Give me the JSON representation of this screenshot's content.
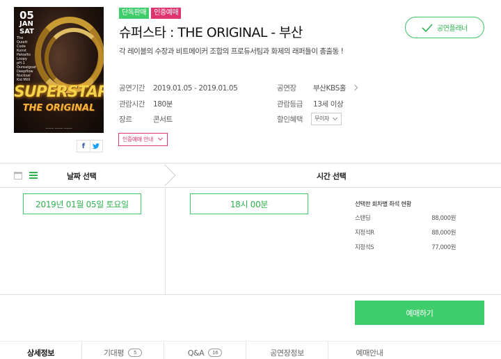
{
  "poster": {
    "date_line1": "05",
    "date_line2": "JAN",
    "date_line3": "SAT",
    "main_title": "SUPERSTAR",
    "sub_title": "THE ORIGINAL"
  },
  "share": {
    "facebook": "f",
    "twitter": "🐦"
  },
  "badges": [
    "단독판매",
    "인증예매"
  ],
  "title": "슈퍼스타 : THE ORIGINAL - 부산",
  "subtitle": "각 레이블의 수장과 비트메이커 조합의 프로듀서팀과 화제의 래퍼들이 총출동 !",
  "partner_button": "공연플래너",
  "info": {
    "period_label": "공연기간",
    "period_value": "2019.01.05 - 2019.01.05",
    "runtime_label": "관람시간",
    "runtime_value": "180분",
    "genre_label": "장르",
    "genre_value": "콘서트",
    "venue_label": "공연장",
    "venue_value": "부산KBS홀",
    "rating_label": "관람등급",
    "rating_value": "13세 이상",
    "discount_label": "할인혜택",
    "discount_value": "무이자"
  },
  "cert_guide": "인증예매 안내",
  "booking": {
    "step_date": "날짜 선택",
    "step_time": "시간 선택",
    "selected_date": "2019년 01월 05일 토요일",
    "selected_time": "18시 00분",
    "seat_header": "선택한 회차별 좌석 현황",
    "seats": [
      {
        "name": "스탠딩",
        "price": "88,000원"
      },
      {
        "name": "지정석R",
        "price": "88,000원"
      },
      {
        "name": "지정석S",
        "price": "77,000원"
      }
    ],
    "book_button": "예매하기"
  },
  "tabs": [
    {
      "label": "상세정보",
      "count": ""
    },
    {
      "label": "기대평",
      "count": "5"
    },
    {
      "label": "Q&A",
      "count": "16"
    },
    {
      "label": "공연장정보",
      "count": ""
    },
    {
      "label": "예매안내",
      "count": ""
    }
  ],
  "colors": {
    "accent_green": "#3fcc6a",
    "accent_pink": "#e0346e"
  }
}
